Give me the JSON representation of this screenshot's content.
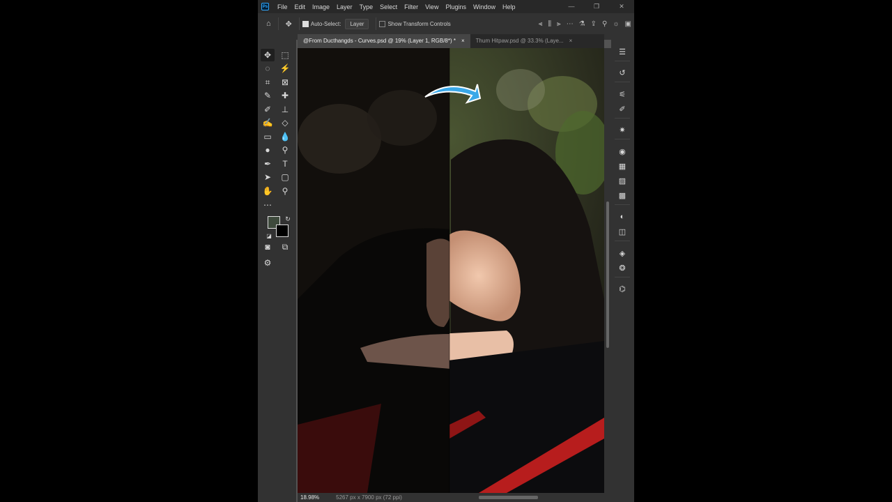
{
  "app": {
    "menu": [
      "File",
      "Edit",
      "Image",
      "Layer",
      "Type",
      "Select",
      "Filter",
      "View",
      "Plugins",
      "Window",
      "Help"
    ],
    "logo": "Ps",
    "window_controls": [
      "—",
      "❐",
      "✕"
    ]
  },
  "options": {
    "auto_select_label": "Auto-Select:",
    "auto_select_checked": true,
    "layer_dropdown": "Layer",
    "transform_label": "Show Transform Controls",
    "transform_checked": false
  },
  "tabs": [
    {
      "label": "@From Ducthangds - Curves.psd @ 19% (Layer 1, RGB/8*) *",
      "close": "×",
      "active": true
    },
    {
      "label": "Thum Hitpaw.psd @ 33.3% (Laye...",
      "close": "×",
      "active": false
    }
  ],
  "status": {
    "zoom": "18.98%",
    "dimensions": "5267 px x 7900 px (72 ppi)"
  },
  "colors": {
    "foreground": "#3e4a3c",
    "background": "#000000",
    "arrow": "#3aa8e8"
  },
  "tools": [
    "move-tool",
    "marquee-tool",
    "lasso-tool",
    "magic-wand-tool",
    "crop-tool",
    "frame-tool",
    "eyedropper-tool",
    "healing-brush-tool",
    "brush-tool",
    "stamp-tool",
    "history-brush-tool",
    "eraser-tool",
    "gradient-tool",
    "blur-tool",
    "dodge-tool",
    "burn-tool",
    "pen-tool",
    "type-tool",
    "path-selection-tool",
    "rectangle-tool",
    "hand-tool",
    "zoom-tool",
    "more-tools"
  ],
  "type_tool_glyph": "T"
}
